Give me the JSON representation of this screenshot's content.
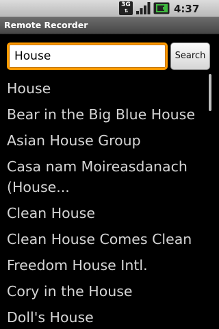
{
  "status_bar": {
    "network_type": "3G",
    "signal_icon": "signal-bars-icon",
    "battery_icon": "battery-charging-icon",
    "time": "4:37 PM"
  },
  "title_bar": {
    "title": "Remote Recorder"
  },
  "search": {
    "value": "House",
    "button_label": "Search"
  },
  "results": [
    "House",
    "Bear in the Big Blue House",
    "Asian House Group",
    "Casa nam Moireasdanach (House...",
    "Clean House",
    "Clean House Comes Clean",
    "Freedom House Intl.",
    "Cory in the House",
    "Doll's House"
  ],
  "colors": {
    "focus_border": "#ff9a00",
    "battery_green": "#3fb93f",
    "list_text": "#d6d6d6"
  }
}
